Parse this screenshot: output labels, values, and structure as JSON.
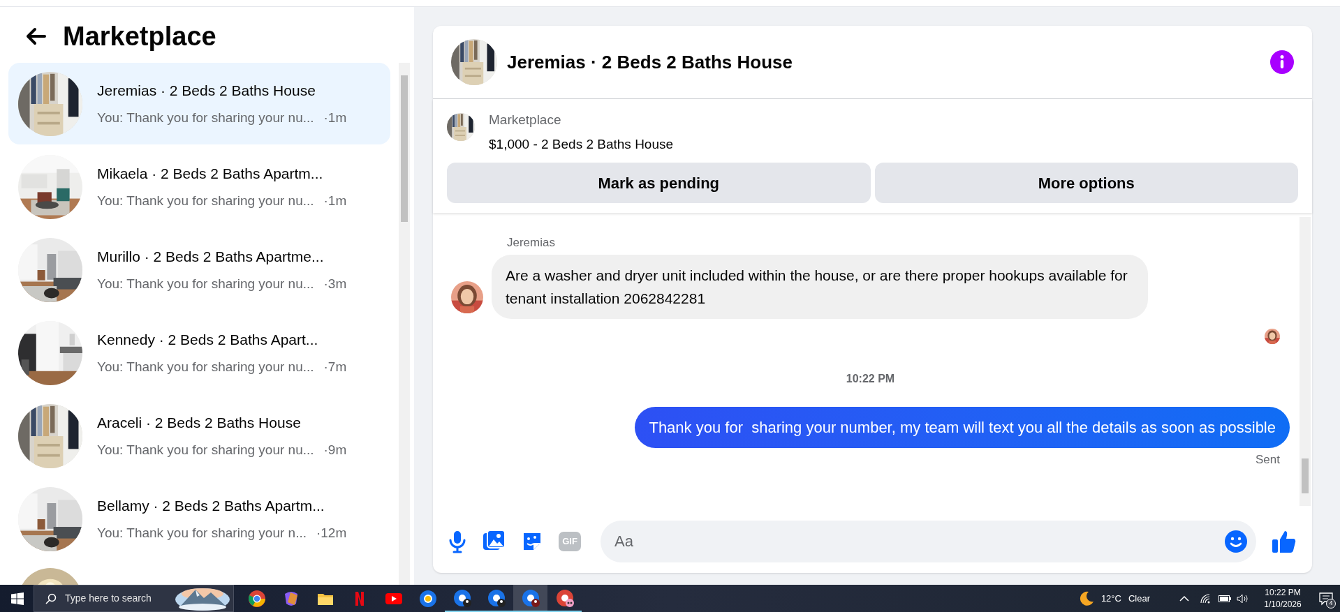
{
  "header": {
    "title": "Marketplace"
  },
  "conversations": [
    {
      "name": "Jeremias · 2 Beds 2 Baths House",
      "preview": "You: Thank you for sharing your nu...",
      "time": "·1m",
      "selected": true
    },
    {
      "name": "Mikaela · 2 Beds 2 Baths Apartm...",
      "preview": "You: Thank you for sharing your nu...",
      "time": "·1m",
      "selected": false
    },
    {
      "name": "Murillo · 2 Beds 2 Baths Apartme...",
      "preview": "You: Thank you for sharing your nu...",
      "time": "·3m",
      "selected": false
    },
    {
      "name": "Kennedy · 2 Beds 2 Baths Apart...",
      "preview": "You: Thank you for sharing your nu...",
      "time": "·7m",
      "selected": false
    },
    {
      "name": "Araceli · 2 Beds 2 Baths House",
      "preview": "You: Thank you for sharing your nu...",
      "time": "·9m",
      "selected": false
    },
    {
      "name": "Bellamy · 2 Beds 2 Baths Apartm...",
      "preview": "You: Thank you for sharing your n...",
      "time": "·12m",
      "selected": false
    }
  ],
  "chat": {
    "title": "Jeremias · 2 Beds 2 Baths House",
    "listing": {
      "label": "Marketplace",
      "title": "$1,000 - 2 Beds 2 Baths House"
    },
    "actions": [
      "Mark as pending",
      "More options"
    ],
    "messages": [
      {
        "kind": "incoming",
        "sender": "Jeremias",
        "text": "Are a washer and dryer unit included within the house, or are there proper hookups available for tenant installation 2062842281"
      },
      {
        "kind": "timestamp",
        "text": "10:22 PM"
      },
      {
        "kind": "outgoing",
        "text": "Thank you for  sharing your number, my team will text you all the details as soon as possible",
        "status": "Sent"
      }
    ],
    "composer": {
      "placeholder": "Aa",
      "gif_label": "GIF"
    }
  },
  "taskbar": {
    "search_placeholder": "Type here to search",
    "temperature": "12°C",
    "weather": "Clear",
    "time": "10:22 PM",
    "date": "1/10/2026",
    "notifications": "4"
  }
}
